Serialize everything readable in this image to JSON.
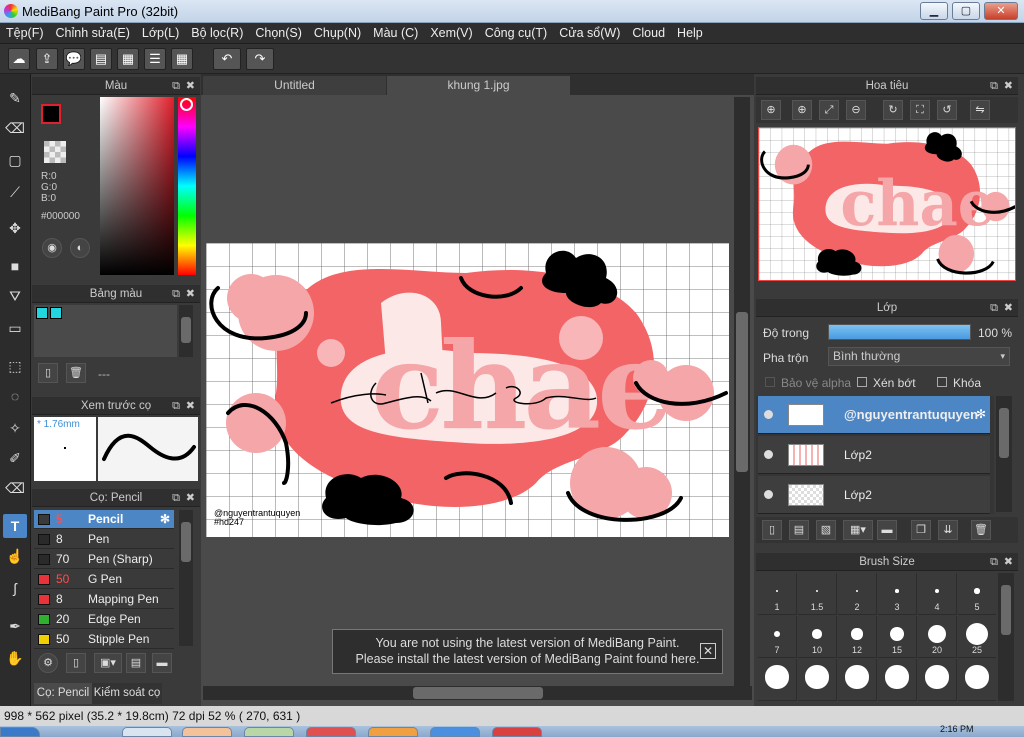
{
  "window": {
    "title": "MediBang Paint Pro (32bit)",
    "min": "▁",
    "max": "▢",
    "close": "✕"
  },
  "menu": [
    "Tệp(F)",
    "Chỉnh sửa(E)",
    "Lớp(L)",
    "Bộ lọc(R)",
    "Chọn(S)",
    "Chụp(N)",
    "Màu (C)",
    "Xem(V)",
    "Công cụ(T)",
    "Cửa sổ(W)",
    "Cloud",
    "Help"
  ],
  "toolbar": {
    "icons": [
      "cloud-icon",
      "upload-icon",
      "speech-bubble-icon",
      "comment-icon",
      "page-icon",
      "list-icon",
      "grid-icon",
      "undo-icon",
      "redo-icon"
    ],
    "glyphs": [
      "☁",
      "⇪",
      "💬",
      "▤",
      "▦",
      "☰",
      "▦",
      "↶",
      "↷"
    ]
  },
  "tools": {
    "icons": [
      "brush-icon",
      "eraser-icon",
      "rectangle-icon",
      "line-icon",
      "move-icon",
      "fill-rect-icon",
      "bucket-icon",
      "gradient-icon",
      "select-rect-icon",
      "lasso-icon",
      "magic-wand-icon",
      "select-pen-icon",
      "select-eraser-icon",
      "text-icon",
      "operation-icon",
      "eyedropper-icon",
      "pen-tool-icon",
      "hand-icon"
    ],
    "glyphs": [
      "✎",
      "⌫",
      "▢",
      "⟋",
      "✥",
      "■",
      "⛛",
      "▭",
      "⬚",
      "◌",
      "✧",
      "✐",
      "⌫",
      "T",
      "☝",
      "ʃ",
      "✒",
      "✋"
    ],
    "selected_index": 13
  },
  "color_panel": {
    "title": "Màu",
    "rgb": [
      "R:0",
      "G:0",
      "B:0"
    ],
    "hex": "#000000",
    "foreground": "#000000",
    "accent_fg_border": "#e0202c",
    "background": "#c46cd6"
  },
  "palette_panel": {
    "title": "Bảng màu",
    "swatches": [
      "#22d6df",
      "#22d6df"
    ],
    "count_text": "---"
  },
  "preview_panel": {
    "title": "Xem trước cọ",
    "size": "* 1.76mm"
  },
  "brush_panel": {
    "title": "Cọ: Pencil",
    "items": [
      {
        "color": "#3a3a3a",
        "size": "5",
        "name": "Pencil",
        "sizeColor": "#ff4d4d"
      },
      {
        "color": "#2a2a2a",
        "size": "8",
        "name": "Pen",
        "sizeColor": "#eeeeee"
      },
      {
        "color": "#2a2a2a",
        "size": "70",
        "name": "Pen (Sharp)",
        "sizeColor": "#eeeeee"
      },
      {
        "color": "#e8333a",
        "size": "50",
        "name": "G Pen",
        "sizeColor": "#ff4d4d"
      },
      {
        "color": "#e8333a",
        "size": "8",
        "name": "Mapping Pen",
        "sizeColor": "#eeeeee"
      },
      {
        "color": "#2fb12f",
        "size": "20",
        "name": "Edge Pen",
        "sizeColor": "#eeeeee"
      },
      {
        "color": "#f0d000",
        "size": "50",
        "name": "Stipple Pen",
        "sizeColor": "#eeeeee"
      }
    ],
    "bottom_tabs": [
      "Cọ: Pencil",
      "Kiểm soát cọ"
    ]
  },
  "doc_tabs": [
    "Untitled",
    "khung 1.jpg"
  ],
  "artwork": {
    "word": "chae",
    "signature": "@nguyentrantuquyen",
    "tag": "#hd247"
  },
  "navigator_panel": {
    "title": "Hoa tiêu"
  },
  "layer_panel": {
    "title": "Lớp",
    "opacity_label": "Độ trong",
    "opacity_value": "100 %",
    "opacity": 1.0,
    "blend_label": "Pha trộn",
    "blend_value": "Bình thường",
    "protect_alpha": "Bảo vệ alpha",
    "clipping": "Xén bớt",
    "lock": "Khóa",
    "layers": [
      {
        "name": "@nguyentrantuquyen",
        "selected": true
      },
      {
        "name": "Lớp2",
        "selected": false
      },
      {
        "name": "Lớp2",
        "selected": false
      }
    ]
  },
  "brush_size_panel": {
    "title": "Brush Size",
    "sizes": [
      "1",
      "1.5",
      "2",
      "3",
      "4",
      "5",
      "7",
      "10",
      "12",
      "15",
      "20",
      "25",
      "",
      "",
      "",
      "",
      "",
      ""
    ],
    "dots": [
      1,
      1.5,
      2,
      3,
      4,
      5,
      7,
      10,
      12,
      15,
      20,
      25,
      26,
      26,
      26,
      26,
      26,
      26
    ]
  },
  "notice": {
    "line1": "You are not using the latest version of MediBang Paint.",
    "line2": "Please install the latest version of MediBang Paint found here."
  },
  "status": {
    "text": "998 * 562 pixel   (35.2 * 19.8cm)   72 dpi   52 %   ( 270, 631 )"
  },
  "taskbar": {
    "clock": "2:16 PM"
  }
}
